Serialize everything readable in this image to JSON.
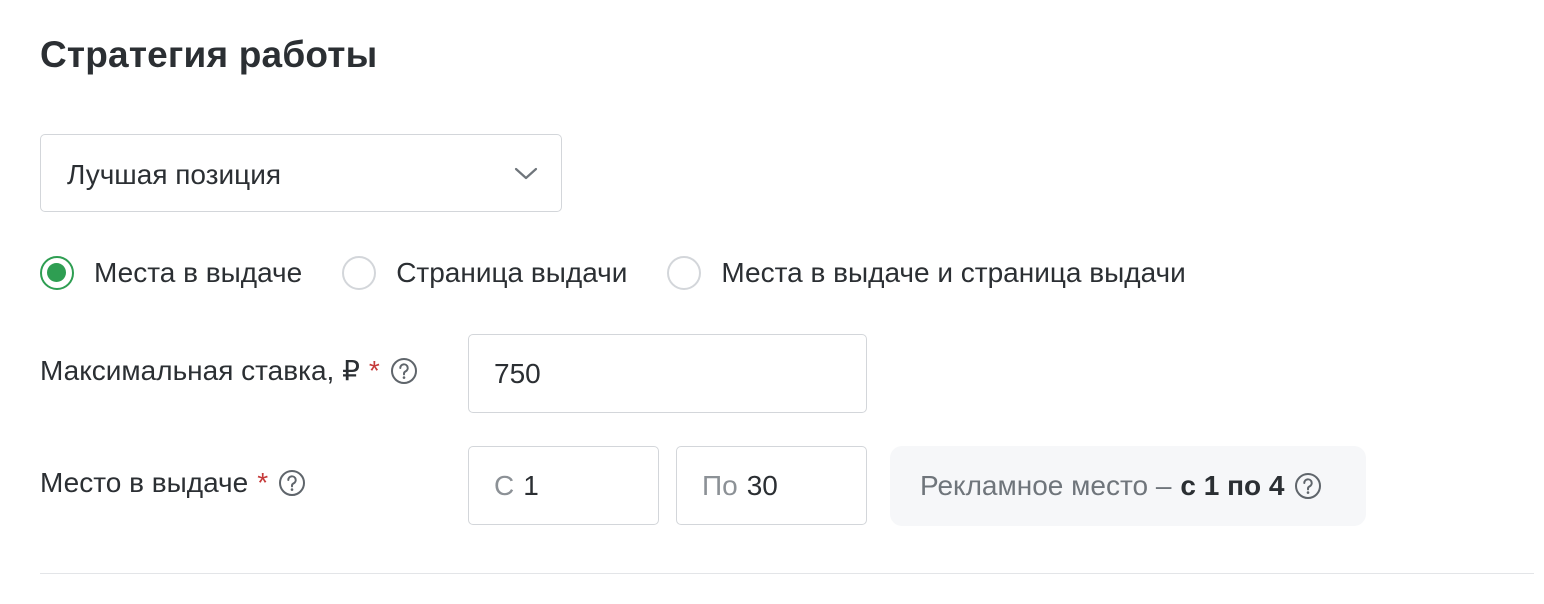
{
  "section": {
    "title": "Стратегия работы"
  },
  "strategy_select": {
    "value": "Лучшая позиция",
    "icon": "chevron-down-icon"
  },
  "radio_group": {
    "options": [
      {
        "label": "Места в выдаче",
        "checked": true
      },
      {
        "label": "Страница выдачи",
        "checked": false
      },
      {
        "label": "Места в выдаче и страница выдачи",
        "checked": false
      }
    ]
  },
  "max_bid": {
    "label": "Максимальная ставка, ₽",
    "required_mark": "*",
    "value": "750",
    "icon": "help-icon"
  },
  "position": {
    "label": "Место в выдаче",
    "required_mark": "*",
    "from_prefix": "С",
    "from_value": "1",
    "to_prefix": "По",
    "to_value": "30",
    "icon": "help-icon"
  },
  "hint": {
    "text": "Рекламное место –",
    "strong": "с 1 по 4",
    "icon": "help-icon"
  },
  "colors": {
    "accent": "#2e9e52",
    "required": "#c53a3a",
    "border": "#d3d6da",
    "hint_bg": "#f6f7f9"
  }
}
